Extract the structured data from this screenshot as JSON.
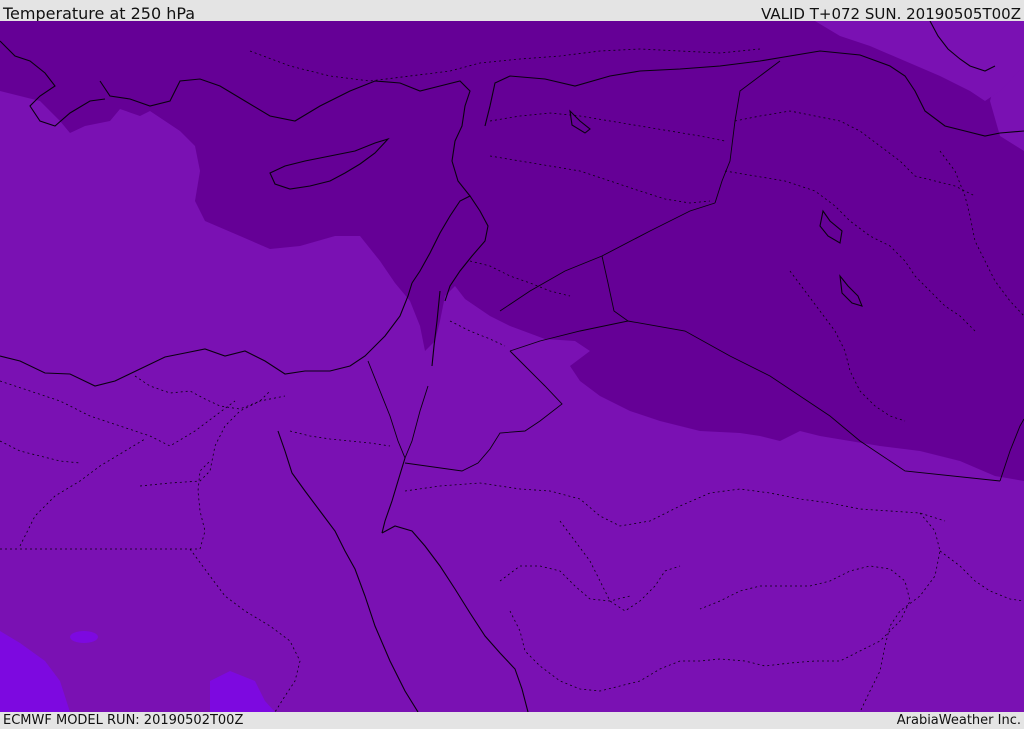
{
  "header": {
    "title": "Temperature at 250 hPa",
    "valid": "VALID T+072 SUN. 20190505T00Z"
  },
  "footer": {
    "model_run": "ECMWF MODEL RUN: 20190502T00Z",
    "brand": "ArabiaWeather Inc."
  },
  "colors": {
    "background": "#e4e4e4",
    "field_mid": "#7a11b3",
    "field_cold": "#650096",
    "field_warm": "#7d09e0",
    "coastline": "#0a0010"
  }
}
